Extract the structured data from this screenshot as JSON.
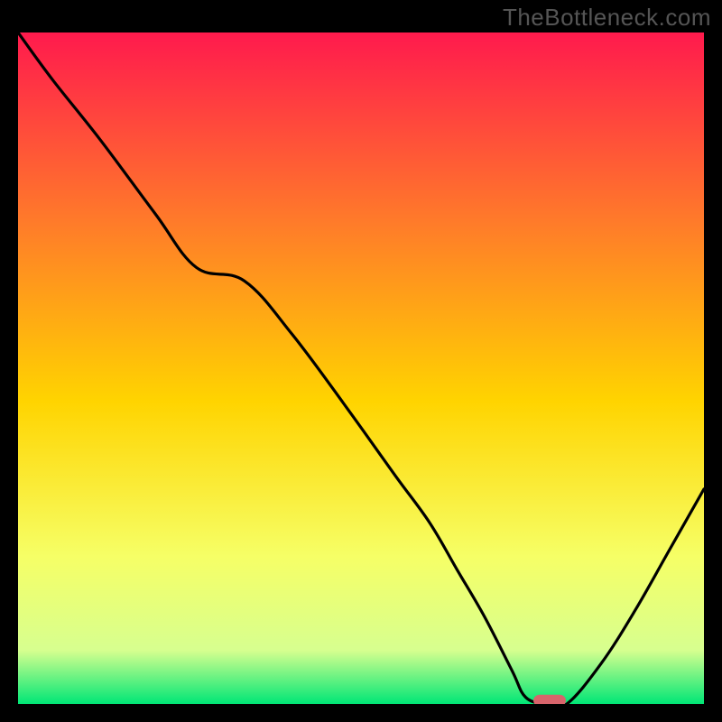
{
  "watermark": "TheBottleneck.com",
  "chart_data": {
    "type": "line",
    "title": "",
    "xlabel": "",
    "ylabel": "",
    "xlim": [
      0,
      100
    ],
    "ylim": [
      0,
      100
    ],
    "grid": false,
    "legend": false,
    "background_gradient": {
      "top": "#ff1a4d",
      "upper_mid": "#ff7a2a",
      "mid": "#ffd400",
      "lower_mid": "#f6ff66",
      "near_bottom": "#d7ff8f",
      "bottom": "#00e676"
    },
    "curve_points": {
      "x": [
        0,
        5,
        12,
        20,
        26,
        33,
        40,
        48,
        55,
        60,
        64,
        68,
        72,
        74,
        77,
        80,
        85,
        90,
        95,
        100
      ],
      "y": [
        100,
        93,
        84,
        73,
        65,
        63,
        55,
        44,
        34,
        27,
        20,
        13,
        5,
        1,
        0,
        0,
        6,
        14,
        23,
        32
      ]
    },
    "marker": {
      "x": 77.5,
      "y": 0.5,
      "color": "#d8646b",
      "shape": "pill"
    }
  }
}
